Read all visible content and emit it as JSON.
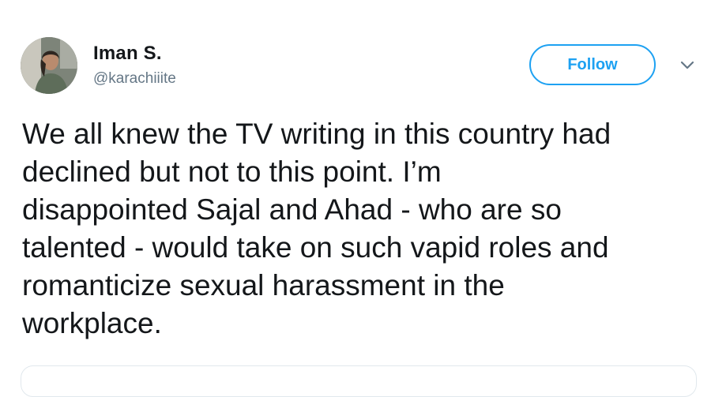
{
  "tweet": {
    "author": {
      "display_name": "Iman S.",
      "handle": "@karachiiite",
      "avatar_icon": "profile-photo"
    },
    "follow_label": "Follow",
    "menu_icon": "chevron-down-icon",
    "text": "We all knew the TV writing in this country had\ndeclined but not to this point. I’m\ndisappointed Sajal and Ahad - who are so\ntalented - would take on such vapid roles and\nromanticize sexual harassment in the\nworkplace."
  },
  "colors": {
    "accent": "#1da1f2",
    "text": "#14171a",
    "secondary_text": "#657786",
    "border": "#e1e8ed"
  }
}
